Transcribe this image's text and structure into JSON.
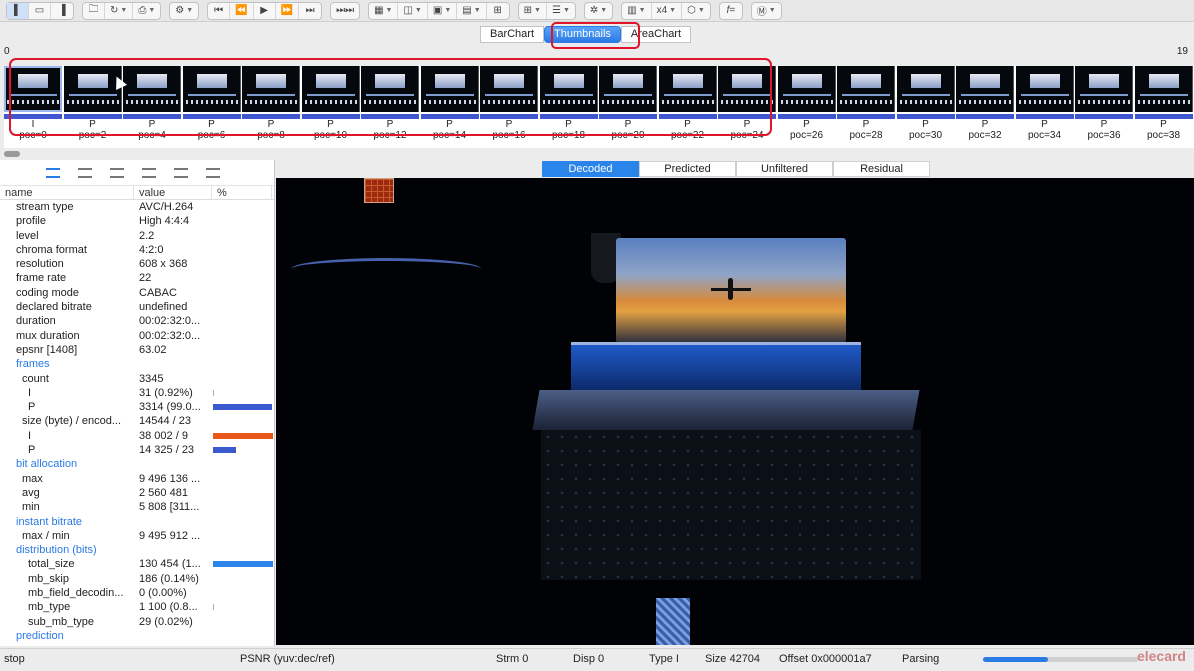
{
  "toolbar": {
    "zoom_label": "x4",
    "fx_label": "f="
  },
  "view_tabs": [
    {
      "label": "BarChart",
      "active": false
    },
    {
      "label": "Thumbnails",
      "active": true
    },
    {
      "label": "AreaChart",
      "active": false
    }
  ],
  "ruler": {
    "start": "0",
    "end": "19"
  },
  "thumbnails": [
    {
      "type": "I",
      "poc": "poc=0"
    },
    {
      "type": "P",
      "poc": "poc=2"
    },
    {
      "type": "P",
      "poc": "poc=4"
    },
    {
      "type": "P",
      "poc": "poc=6"
    },
    {
      "type": "P",
      "poc": "poc=8"
    },
    {
      "type": "P",
      "poc": "poc=10"
    },
    {
      "type": "P",
      "poc": "poc=12"
    },
    {
      "type": "P",
      "poc": "poc=14"
    },
    {
      "type": "P",
      "poc": "poc=16"
    },
    {
      "type": "P",
      "poc": "poc=18"
    },
    {
      "type": "P",
      "poc": "poc=20"
    },
    {
      "type": "P",
      "poc": "poc=22"
    },
    {
      "type": "P",
      "poc": "poc=24"
    },
    {
      "type": "P",
      "poc": "poc=26"
    },
    {
      "type": "P",
      "poc": "poc=28"
    },
    {
      "type": "P",
      "poc": "poc=30"
    },
    {
      "type": "P",
      "poc": "poc=32"
    },
    {
      "type": "P",
      "poc": "poc=34"
    },
    {
      "type": "P",
      "poc": "poc=36"
    },
    {
      "type": "P",
      "poc": "poc=38"
    }
  ],
  "info_table": {
    "headers": [
      "name",
      "value",
      "%"
    ],
    "rows": [
      {
        "name": "stream type",
        "value": "AVC/H.264",
        "indent": 1
      },
      {
        "name": "profile",
        "value": "High 4:4:4",
        "indent": 1
      },
      {
        "name": "level",
        "value": "2.2",
        "indent": 1
      },
      {
        "name": "chroma format",
        "value": "4:2:0",
        "indent": 1
      },
      {
        "name": "resolution",
        "value": "608 x 368",
        "indent": 1
      },
      {
        "name": "frame rate",
        "value": "22",
        "indent": 1
      },
      {
        "name": "coding mode",
        "value": "CABAC",
        "indent": 1
      },
      {
        "name": "declared bitrate",
        "value": "undefined",
        "indent": 1
      },
      {
        "name": "duration",
        "value": "00:02:32:0...",
        "indent": 1
      },
      {
        "name": "mux duration",
        "value": "00:02:32:0...",
        "indent": 1
      },
      {
        "name": "epsnr [1408]",
        "value": "63.02",
        "indent": 1
      },
      {
        "name": "frames",
        "value": "",
        "indent": 1,
        "section": true
      },
      {
        "name": "count",
        "value": "3345",
        "indent": 2
      },
      {
        "name": "I",
        "value": "31 (0.92%)",
        "indent": 3,
        "bar_pct": 0.92,
        "bar_color": "#b0b0b0"
      },
      {
        "name": "P",
        "value": "3314 (99.0...",
        "indent": 3,
        "bar_pct": 99.08,
        "bar_color": "#3b5ad0"
      },
      {
        "name": "size (byte) / encod...",
        "value": "14544 / 23",
        "indent": 2
      },
      {
        "name": "I",
        "value": "38 002 / 9",
        "indent": 3,
        "bar_pct": 100,
        "bar_color": "#e8561a"
      },
      {
        "name": "P",
        "value": "14 325 / 23",
        "indent": 3,
        "bar_pct": 37.7,
        "bar_color": "#3b5ad0"
      },
      {
        "name": "bit allocation",
        "value": "",
        "indent": 1,
        "section": true
      },
      {
        "name": "max",
        "value": "9 496 136 ...",
        "indent": 2
      },
      {
        "name": "avg",
        "value": "2 560 481",
        "indent": 2
      },
      {
        "name": "min",
        "value": "5 808 [311...",
        "indent": 2
      },
      {
        "name": "instant bitrate",
        "value": "",
        "indent": 1,
        "section": true
      },
      {
        "name": "max / min",
        "value": "9 495 912 ...",
        "indent": 2
      },
      {
        "name": "distribution (bits)",
        "value": "",
        "indent": 1,
        "section": true
      },
      {
        "name": "total_size",
        "value": "130 454 (1...",
        "indent": 3,
        "bar_pct": 100,
        "bar_color": "#2b84ea"
      },
      {
        "name": "mb_skip",
        "value": "186 (0.14%)",
        "indent": 3
      },
      {
        "name": "mb_field_decodin...",
        "value": "0 (0.00%)",
        "indent": 3
      },
      {
        "name": "mb_type",
        "value": "1 100 (0.8...",
        "indent": 3,
        "bar_pct": 0.8,
        "bar_color": "#b0b0b0"
      },
      {
        "name": "sub_mb_type",
        "value": "29 (0.02%)",
        "indent": 3
      },
      {
        "name": "prediction",
        "value": "",
        "indent": 1,
        "section": true
      }
    ]
  },
  "decode_tabs": [
    {
      "label": "Decoded",
      "active": true
    },
    {
      "label": "Predicted",
      "active": false
    },
    {
      "label": "Unfiltered",
      "active": false
    },
    {
      "label": "Residual",
      "active": false
    }
  ],
  "status": {
    "state": "stop",
    "psnr": "PSNR (yuv:dec/ref)",
    "strm": "Strm 0",
    "disp": "Disp 0",
    "type": "Type I",
    "size": "Size 42704",
    "offset": "Offset 0x000001a7",
    "parsing": "Parsing",
    "progress": 0.42
  },
  "watermark": "elecard"
}
